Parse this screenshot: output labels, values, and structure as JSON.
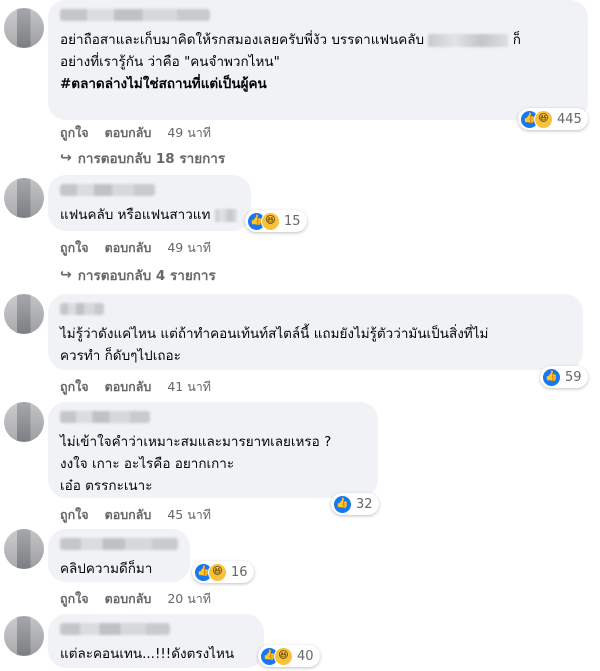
{
  "actions": {
    "like": "ถูกใจ",
    "reply": "ตอบกลับ"
  },
  "comments": [
    {
      "lines": [
        "อย่าถือสาและเก็บมาคิดให้รกสมองเลยครับพี่งัว บรรดาแฟนคลับ",
        "ก็",
        "อย่างที่เรารู้กัน ว่าคือ \"คนจำพวกไหน\"",
        "#ตลาดล่างไม่ใช่สถานที่แต่เป็นผู้คน"
      ],
      "reaction_count": "445",
      "reaction_icons": [
        "like-icon",
        "haha-icon"
      ],
      "time": "49 นาที",
      "replies": "การตอบกลับ 18 รายการ"
    },
    {
      "lines": [
        "แฟนคลับ หรือแฟนสาวแท"
      ],
      "reaction_count": "15",
      "reaction_icons": [
        "like-icon",
        "haha-icon"
      ],
      "time": "49 นาที",
      "replies": "การตอบกลับ 4 รายการ"
    },
    {
      "lines": [
        "ไม่รู้ว่าดังแค่ไหน แต่ถ้าทำคอนเท้นท์สไตล์นี้ แถมยังไม่รู้ตัวว่ามันเป็นสิ่งที่ไม่",
        "ควรทำ ก็ดับๆไปเถอะ"
      ],
      "reaction_count": "59",
      "reaction_icons": [
        "like-icon"
      ],
      "time": "41 นาที"
    },
    {
      "lines": [
        "ไม่เข้าใจคำว่าเหมาะสมและมารยาทเลยเหรอ ?",
        "งงใจ เกาะ อะไรคือ อยากเกาะ",
        "เอ๋อ ตรรกะเนาะ"
      ],
      "reaction_count": "32",
      "reaction_icons": [
        "like-icon"
      ],
      "time": "45 นาที"
    },
    {
      "lines": [
        "คลิปความดีก็มา"
      ],
      "reaction_count": "16",
      "reaction_icons": [
        "like-icon",
        "haha-icon"
      ],
      "time": "20 นาที"
    },
    {
      "lines": [
        "แต่ละคอนเทน...!!!ดังตรงไหน"
      ],
      "reaction_count": "40",
      "reaction_icons": [
        "like-icon",
        "haha-icon"
      ]
    }
  ],
  "colors": {
    "bubble": "#f0f2f5",
    "meta_text": "#65676b",
    "like_blue": "#1877f2",
    "haha_yellow": "#f7c23b"
  }
}
